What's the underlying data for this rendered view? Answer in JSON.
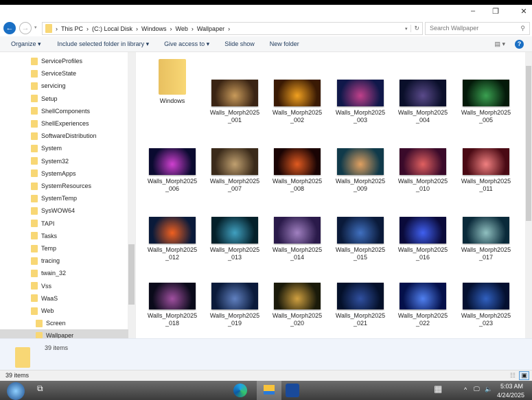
{
  "window": {
    "minimize": "–",
    "maximize": "❐",
    "close": "✕"
  },
  "address": {
    "crumbs": [
      "This PC",
      "(C:) Local Disk",
      "Windows",
      "Web",
      "Wallpaper"
    ],
    "search_placeholder": "Search Wallpaper"
  },
  "toolbar": {
    "organize": "Organize ▾",
    "include": "Include selected folder in library ▾",
    "give_access": "Give access to ▾",
    "slide_show": "Slide show",
    "new_folder": "New folder",
    "help": "?"
  },
  "nav": {
    "items": [
      "ServiceProfiles",
      "ServiceState",
      "servicing",
      "Setup",
      "ShellComponents",
      "ShellExperiences",
      "SoftwareDistribution",
      "System",
      "System32",
      "SystemApps",
      "SystemResources",
      "SystemTemp",
      "SysWOW64",
      "TAPI",
      "Tasks",
      "Temp",
      "tracing",
      "twain_32",
      "Vss",
      "WaaS",
      "Web",
      "Screen",
      "Wallpaper"
    ]
  },
  "files": [
    {
      "name": "Windows",
      "type": "folder"
    },
    {
      "name": "Walls_Morph2025_001",
      "c": [
        "#3a2414",
        "#c89a5a"
      ]
    },
    {
      "name": "Walls_Morph2025_002",
      "c": [
        "#3a1a04",
        "#f0a020"
      ]
    },
    {
      "name": "Walls_Morph2025_003",
      "c": [
        "#10184a",
        "#c0408a"
      ]
    },
    {
      "name": "Walls_Morph2025_004",
      "c": [
        "#0a0f2a",
        "#5a4a8a"
      ]
    },
    {
      "name": "Walls_Morph2025_005",
      "c": [
        "#041a0a",
        "#3aa050"
      ]
    },
    {
      "name": "Walls_Morph2025_006",
      "c": [
        "#0a0a30",
        "#d040d0"
      ]
    },
    {
      "name": "Walls_Morph2025_007",
      "c": [
        "#3a2a1a",
        "#c0a070"
      ]
    },
    {
      "name": "Walls_Morph2025_008",
      "c": [
        "#1a0404",
        "#e05a20"
      ]
    },
    {
      "name": "Walls_Morph2025_009",
      "c": [
        "#103a4a",
        "#e0a060"
      ]
    },
    {
      "name": "Walls_Morph2025_010",
      "c": [
        "#3a0a2a",
        "#e06060"
      ]
    },
    {
      "name": "Walls_Morph2025_011",
      "c": [
        "#4a0a14",
        "#f08080"
      ]
    },
    {
      "name": "Walls_Morph2025_012",
      "c": [
        "#0a1a3a",
        "#f06020"
      ]
    },
    {
      "name": "Walls_Morph2025_013",
      "c": [
        "#04202a",
        "#40a0c0"
      ]
    },
    {
      "name": "Walls_Morph2025_014",
      "c": [
        "#2a1a4a",
        "#a080c0"
      ]
    },
    {
      "name": "Walls_Morph2025_015",
      "c": [
        "#0a1a3a",
        "#4070c0"
      ]
    },
    {
      "name": "Walls_Morph2025_016",
      "c": [
        "#0a0a3a",
        "#4060f0"
      ]
    },
    {
      "name": "Walls_Morph2025_017",
      "c": [
        "#0a2a3a",
        "#90c0c0"
      ]
    },
    {
      "name": "Walls_Morph2025_018",
      "c": [
        "#0a0a1a",
        "#a050a0"
      ]
    },
    {
      "name": "Walls_Morph2025_019",
      "c": [
        "#0a1a3a",
        "#6080c0"
      ]
    },
    {
      "name": "Walls_Morph2025_020",
      "c": [
        "#1a1a0a",
        "#d0a040"
      ]
    },
    {
      "name": "Walls_Morph2025_021",
      "c": [
        "#04102a",
        "#3050a0"
      ]
    },
    {
      "name": "Walls_Morph2025_022",
      "c": [
        "#04104a",
        "#5080f0"
      ]
    },
    {
      "name": "Walls_Morph2025_023",
      "c": [
        "#041030",
        "#3060c0"
      ]
    }
  ],
  "details": {
    "count": "39 items"
  },
  "status": {
    "count": "39 items"
  },
  "taskbar": {
    "time": "5:03 AM",
    "date": "4/24/2025"
  }
}
